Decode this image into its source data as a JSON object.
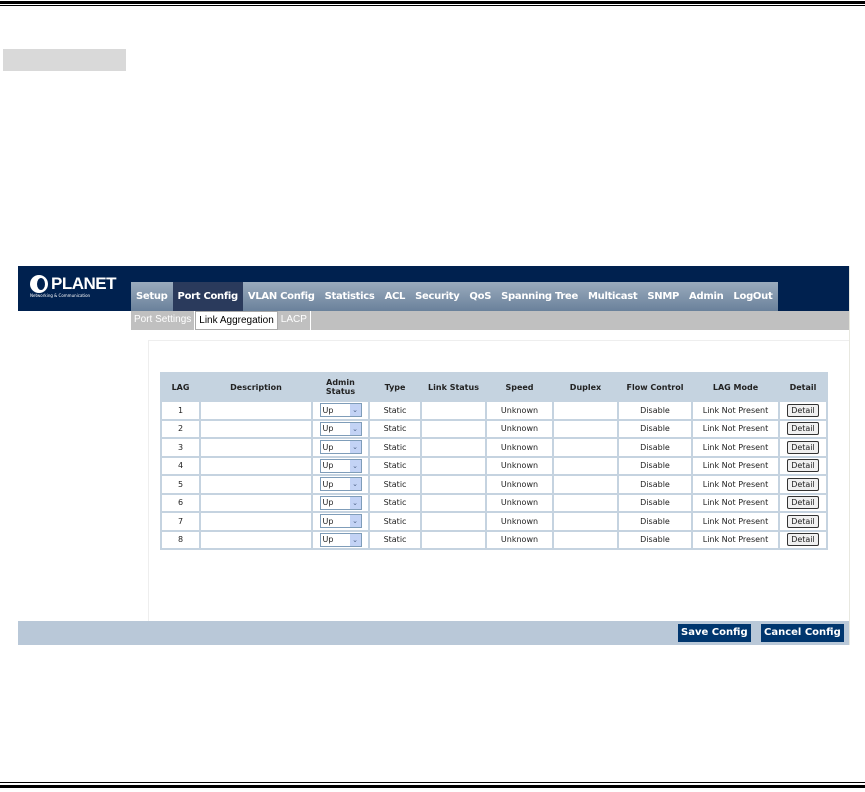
{
  "logo": {
    "name": "PLANET",
    "tagline": "Networking & Communication"
  },
  "nav": [
    "Setup",
    "Port Config",
    "VLAN Config",
    "Statistics",
    "ACL",
    "Security",
    "QoS",
    "Spanning Tree",
    "Multicast",
    "SNMP",
    "Admin",
    "LogOut"
  ],
  "nav_active": "Port Config",
  "subnav": [
    "Port Settings",
    "Link Aggregation",
    "LACP"
  ],
  "subnav_active": "Link Aggregation",
  "table": {
    "headers": [
      "LAG",
      "Description",
      "Admin Status",
      "Type",
      "Link Status",
      "Speed",
      "Duplex",
      "Flow Control",
      "LAG Mode",
      "Detail"
    ],
    "rows": [
      {
        "lag": "1",
        "description": "",
        "admin": "Up",
        "type": "Static",
        "link": "",
        "speed": "Unknown",
        "duplex": "",
        "flow": "Disable",
        "mode": "Link Not Present",
        "detail": "Detail"
      },
      {
        "lag": "2",
        "description": "",
        "admin": "Up",
        "type": "Static",
        "link": "",
        "speed": "Unknown",
        "duplex": "",
        "flow": "Disable",
        "mode": "Link Not Present",
        "detail": "Detail"
      },
      {
        "lag": "3",
        "description": "",
        "admin": "Up",
        "type": "Static",
        "link": "",
        "speed": "Unknown",
        "duplex": "",
        "flow": "Disable",
        "mode": "Link Not Present",
        "detail": "Detail"
      },
      {
        "lag": "4",
        "description": "",
        "admin": "Up",
        "type": "Static",
        "link": "",
        "speed": "Unknown",
        "duplex": "",
        "flow": "Disable",
        "mode": "Link Not Present",
        "detail": "Detail"
      },
      {
        "lag": "5",
        "description": "",
        "admin": "Up",
        "type": "Static",
        "link": "",
        "speed": "Unknown",
        "duplex": "",
        "flow": "Disable",
        "mode": "Link Not Present",
        "detail": "Detail"
      },
      {
        "lag": "6",
        "description": "",
        "admin": "Up",
        "type": "Static",
        "link": "",
        "speed": "Unknown",
        "duplex": "",
        "flow": "Disable",
        "mode": "Link Not Present",
        "detail": "Detail"
      },
      {
        "lag": "7",
        "description": "",
        "admin": "Up",
        "type": "Static",
        "link": "",
        "speed": "Unknown",
        "duplex": "",
        "flow": "Disable",
        "mode": "Link Not Present",
        "detail": "Detail"
      },
      {
        "lag": "8",
        "description": "",
        "admin": "Up",
        "type": "Static",
        "link": "",
        "speed": "Unknown",
        "duplex": "",
        "flow": "Disable",
        "mode": "Link Not Present",
        "detail": "Detail"
      }
    ]
  },
  "footer": {
    "save": "Save Config",
    "cancel": "Cancel Config"
  }
}
